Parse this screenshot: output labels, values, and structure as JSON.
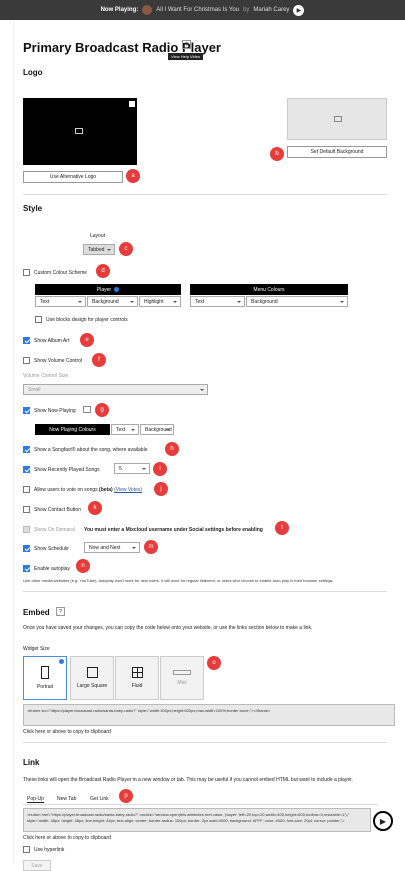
{
  "topbar": {
    "now_playing_label": "Now Playing:",
    "track": "All I Want For Christmas Is You",
    "by": "by",
    "artist": "Mariah Carey"
  },
  "header": {
    "title": "Primary Broadcast Radio Player",
    "help_tooltip": "View Help Video"
  },
  "logo": {
    "heading": "Logo",
    "use_alt_logo": "Use Alternative Logo",
    "set_default_bg": "Set Default Background",
    "badge_a": "a",
    "badge_b": "b"
  },
  "style": {
    "heading": "Style",
    "layout_label": "Layout",
    "layout_value": "Tabbed",
    "badge_c": "c",
    "custom_colour": "Custom Colour Scheme",
    "badge_d": "d",
    "player_bar": "Player",
    "menu_colours_bar": "Menu Colours",
    "player_selects": [
      "Text",
      "Background",
      "Highlight"
    ],
    "menu_selects": [
      "Text",
      "Background"
    ],
    "use_blocks": "Use blocks design for player controls",
    "show_album_art": "Show Album Art",
    "badge_e": "e",
    "show_volume": "Show Volume Control",
    "badge_f": "f",
    "volume_size_label": "Volume Control Size",
    "volume_size_value": "Small",
    "show_now_playing": "Show Now Playing",
    "badge_g": "g",
    "now_playing_colours": "Now Playing Colours",
    "np_selects": [
      "Text",
      "Background"
    ],
    "songfact": "Show a Songfact® about the song, where available",
    "badge_h": "h",
    "recently_played": "Show Recently Played Songs",
    "recently_count": "5",
    "badge_i": "i",
    "allow_vote": "Allow users to vote on songs",
    "beta": "(beta)",
    "view_votes": "(View Votes)",
    "badge_j": "j",
    "contact_button": "Show Contact Button",
    "badge_k": "k",
    "on_demand": "Show On Demand",
    "on_demand_note": "You must enter a Mixcloud username under Social settings before enabling",
    "badge_l": "l",
    "show_schedule": "Show Schedule",
    "schedule_value": "Now and Next",
    "badge_m": "m",
    "enable_autoplay": "Enable autoplay",
    "badge_n": "n",
    "autoplay_note": "Like other media websites (e.g. YouTube), autoplay won't work for new users. It will work for regular listeners, or users who choose to enable auto-play in their browser settings."
  },
  "embed": {
    "heading": "Embed",
    "desc": "Once you have saved your changes, you can copy the code below onto your website, or use the links section below to make a link.",
    "widget_size_label": "Widget Size",
    "tiles": [
      "Portrait",
      "Large Square",
      "Fluid",
      "Mini"
    ],
    "badge_o": "o",
    "code": "<iframe src=\"https://player.broadcast.radio/santa-baby-radio?\" style=\"width:400px;height:600px;max-width:100%;border:none;\"></iframe>",
    "copy_hint": "Click here or above to copy to clipboard"
  },
  "link": {
    "heading": "Link",
    "desc": "These links will open the Broadcast Radio Player in a new window or tab. This may be useful if you cannot embed HTML but want to include a player.",
    "tabs": [
      "Pop-Up",
      "New Tab",
      "Get Link"
    ],
    "badge_p": "p",
    "code": "<button href=\"https://player.broadcast.radio/santa-baby-radio?\" onclick=\"window.open(this.attributes.href.value, 'player','left=20,top=20,width=400,height=600,toolbar=0,resizable=1');\" style=\"width: 48px; height: 48px; line-height: 44px; text-align: center; border-radius: 100px; border: 2px solid #000; background: #FFF; color: #000; font-size: 20pt; cursor: pointer;\">",
    "copy_hint": "Click here or above to copy to clipboard",
    "use_hyperlink": "Use hyperlink",
    "save": "Save"
  },
  "colors": {
    "badge": "#e63c3c",
    "accent": "#2c7be5"
  }
}
